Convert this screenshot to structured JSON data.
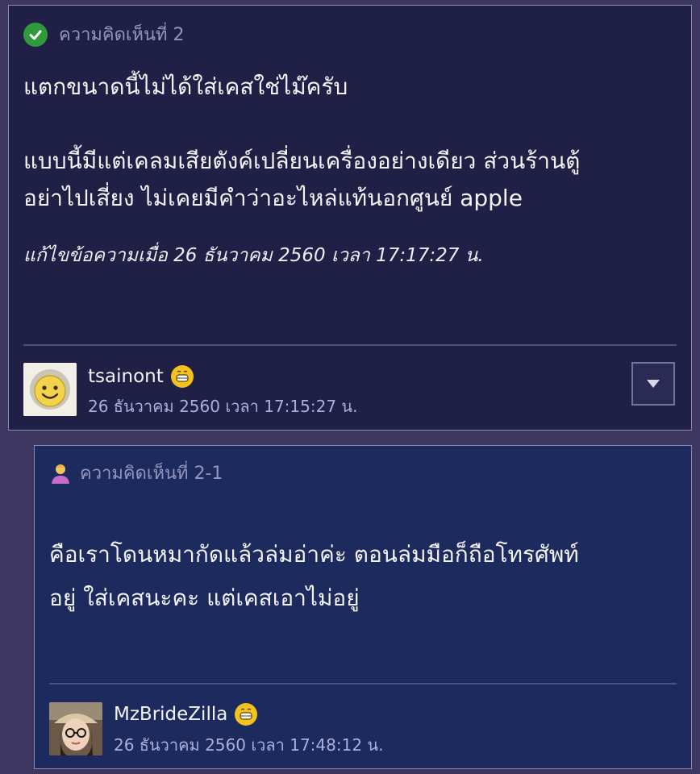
{
  "comments": [
    {
      "header": "ความคิดเห็นที่ 2",
      "body": "แตกขนาดนี้ไม่ได้ใส่เคสใช่ไม๊ครับ\n\nแบบนี้มีแต่เคลมเสียตังค์เปลี่ยนเครื่องอย่างเดียว ส่วนร้านตู้\nอย่าไปเสี่ยง ไม่เคยมีคำว่าอะไหล่แท้นอกศูนย์ apple",
      "edited": "แก้ไขข้อความเมื่อ 26 ธันวาคม 2560 เวลา 17:17:27 น.",
      "user": "tsainont",
      "date": "26 ธันวาคม 2560 เวลา 17:15:27 น.",
      "avatar_icon": "smiley-avatar",
      "badge_icon": "grin-emoji-icon",
      "header_icon": "check-circle-icon"
    },
    {
      "header": "ความคิดเห็นที่ 2-1",
      "body": "คือเราโดนหมากัดแล้วล่มอ่าค่ะ ตอนล่มมือก็ถือโทรศัพท์\nอยู่ ใส่เคสนะคะ แต่เคสเอาไม่อยู่",
      "user": "MzBrideZilla",
      "date": "26 ธันวาคม 2560 เวลา 17:48:12 น.",
      "avatar_icon": "photo-avatar",
      "badge_icon": "grin-emoji-icon",
      "header_icon": "person-icon"
    }
  ],
  "colors": {
    "page_bg": "#3d3660",
    "card1_bg": "#201f45",
    "card2_bg": "#1c2a5e",
    "date_text": "#a9b0dc",
    "check_green": "#2f9a3b"
  }
}
